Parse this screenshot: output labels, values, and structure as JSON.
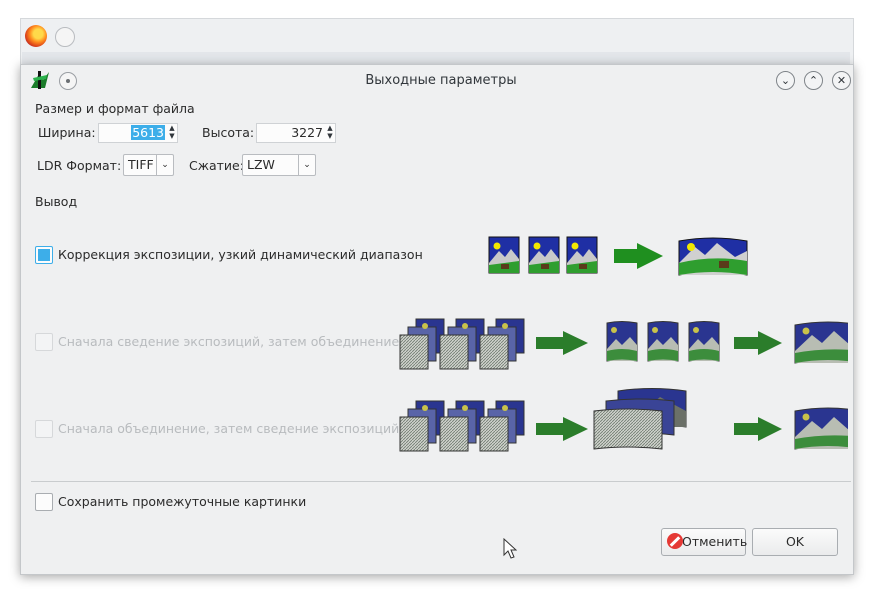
{
  "dialog": {
    "title": "Выходные параметры",
    "section_file": "Размер и формат файла",
    "width_label": "Ширина:",
    "width_value": "5613",
    "height_label": "Высота:",
    "height_value": "3227",
    "ldr_label": "LDR Формат:",
    "ldr_value": "TIFF",
    "compression_label": "Сжатие:",
    "compression_value": "LZW",
    "section_output": "Вывод",
    "option1": "Коррекция экспозиции, узкий динамический диапазон",
    "option2": "Сначала сведение экспозиций, затем объединение",
    "option3": "Сначала объединение, затем сведение экспозиций",
    "save_intermediate": "Сохранить промежуточные картинки",
    "cancel_label": "Отменить",
    "ok_label": "OK"
  },
  "state": {
    "option1_checked": true,
    "option2_enabled": false,
    "option3_enabled": false,
    "save_intermediate_checked": false
  },
  "colors": {
    "accent": "#3daee9",
    "disabled_text": "#b8bbbe",
    "arrow_green": "#1f8f1f",
    "sky_blue": "#2133a8",
    "grass_green": "#2f9e2f"
  },
  "icons": [
    "firefox-icon",
    "hugin-app-icon",
    "pin-icon",
    "minimize-icon",
    "maximize-icon",
    "close-icon",
    "cancel-icon",
    "mouse-cursor-icon"
  ]
}
